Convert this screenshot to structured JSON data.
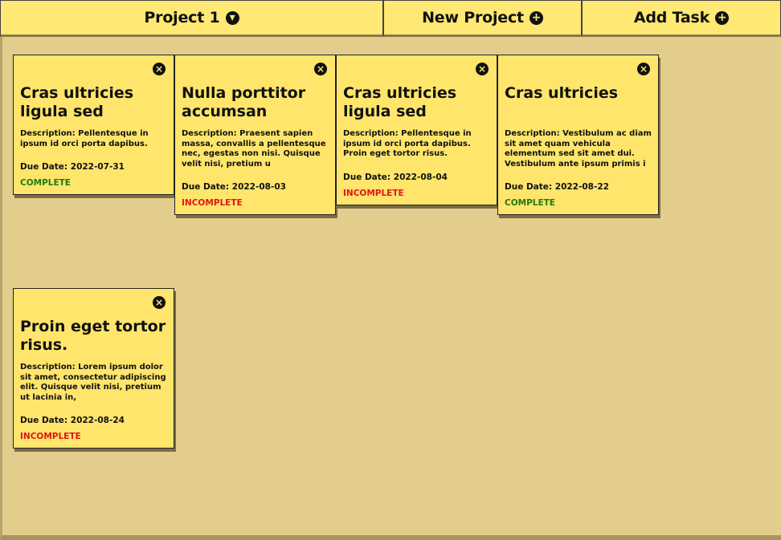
{
  "topbar": {
    "project_label": "Project 1",
    "project_icon": "chevron-down-circle-icon",
    "new_project_label": "New Project",
    "new_project_icon": "plus-circle-icon",
    "add_task_label": "Add Task",
    "add_task_icon": "plus-circle-icon"
  },
  "colors": {
    "background": "#e2cd8c",
    "card": "#ffe56b",
    "complete": "#1e7a12",
    "incomplete": "#e01515"
  },
  "tasks": [
    {
      "title": "Cras ultricies ligula sed",
      "description": "Description: Pellentesque in ipsum id orci porta dapibus.",
      "due": "Due Date: 2022-07-31",
      "status": "COMPLETE"
    },
    {
      "title": "Nulla porttitor accumsan",
      "description": "Description: Praesent sapien massa, convallis a pellentesque nec, egestas non nisi. Quisque velit nisi, pretium u",
      "due": "Due Date: 2022-08-03",
      "status": "INCOMPLETE"
    },
    {
      "title": "Cras ultricies ligula sed",
      "description": "Description: Pellentesque in ipsum id orci porta dapibus. Proin eget tortor risus.",
      "due": "Due Date: 2022-08-04",
      "status": "INCOMPLETE"
    },
    {
      "title": "Cras ultricies",
      "description": "Description: Vestibulum ac diam sit amet quam vehicula elementum sed sit amet dui. Vestibulum ante ipsum primis i",
      "due": "Due Date: 2022-08-22",
      "status": "COMPLETE"
    },
    {
      "title": "Proin eget tortor risus.",
      "description": "Description: Lorem ipsum dolor sit amet, consectetur adipiscing elit. Quisque velit nisi, pretium ut lacinia in,",
      "due": "Due Date: 2022-08-24",
      "status": "INCOMPLETE"
    }
  ]
}
